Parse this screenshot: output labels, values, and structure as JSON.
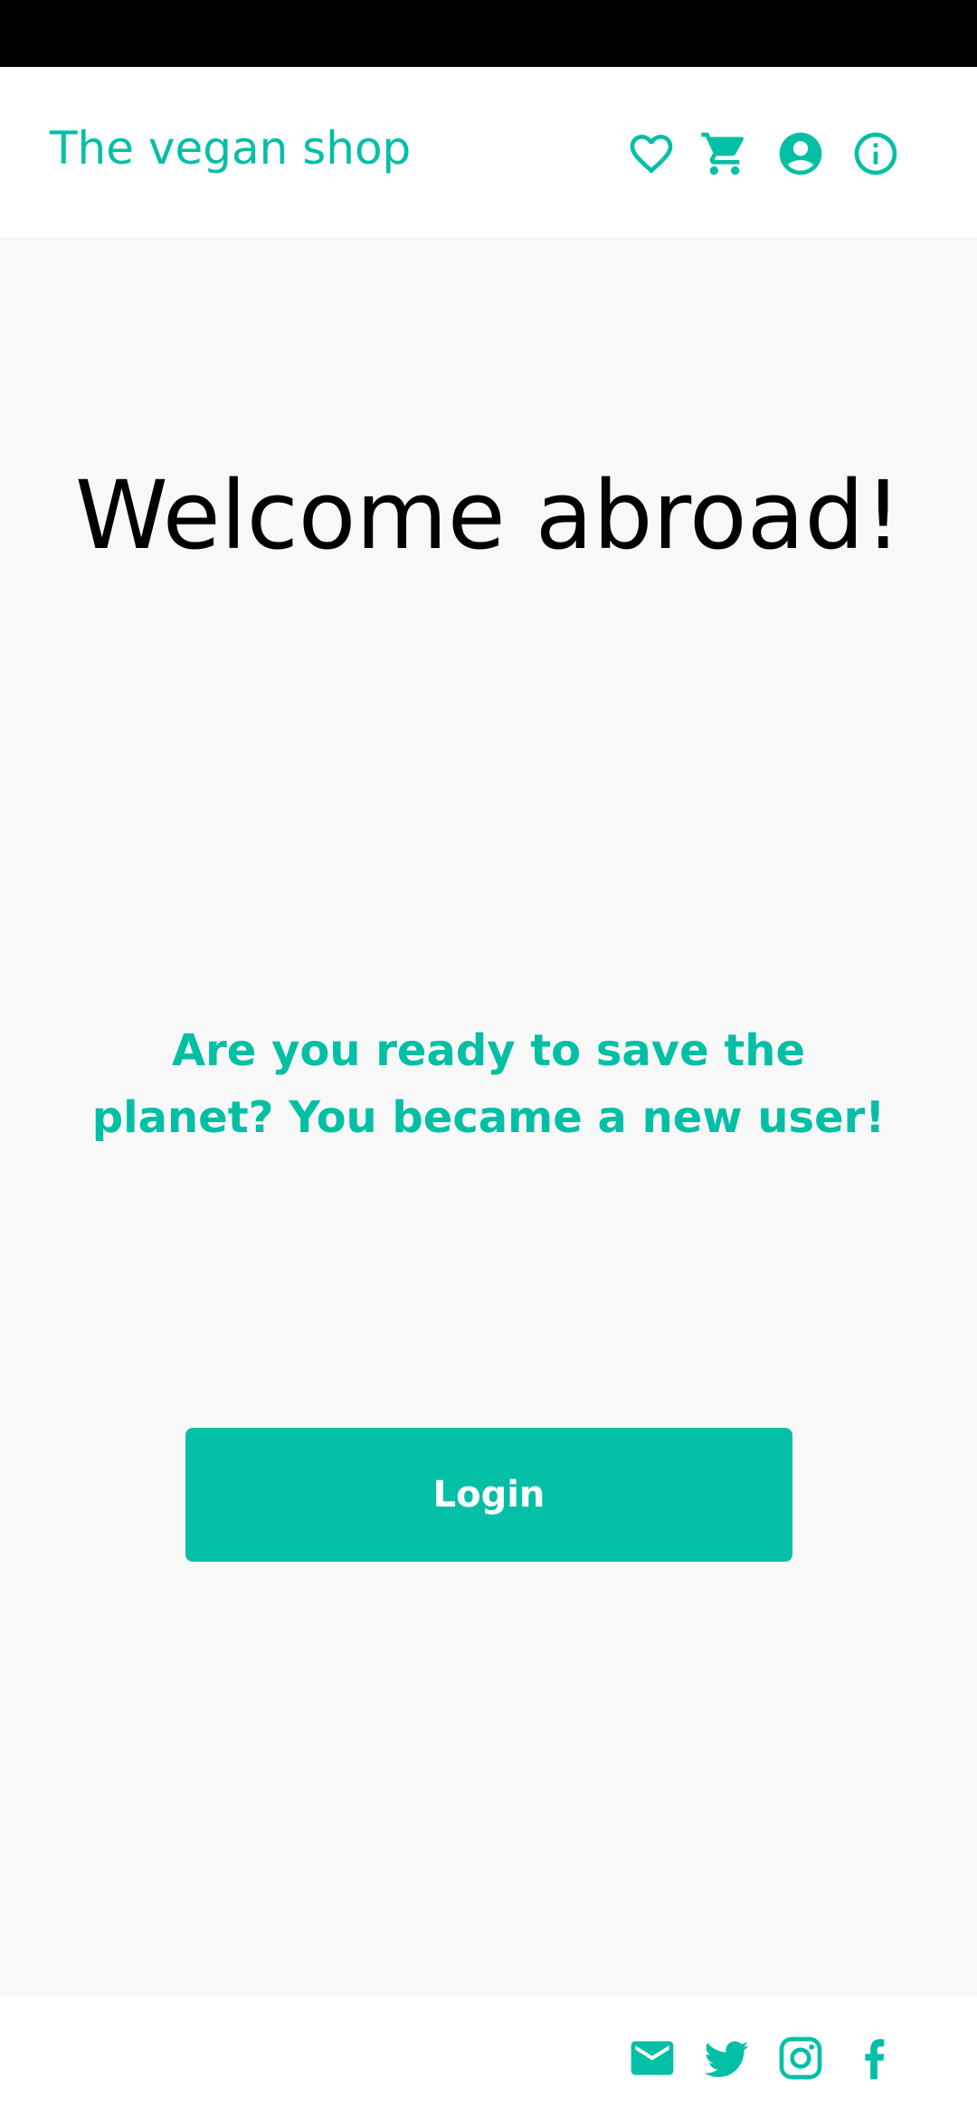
{
  "header": {
    "title": "The vegan shop",
    "icons": [
      "favorite-icon",
      "cart-icon",
      "account-icon",
      "info-icon"
    ]
  },
  "main": {
    "heading": "Welcome abroad!",
    "subtitle": "Are you ready to save the planet? You became a new user!",
    "login_label": "Login"
  },
  "footer": {
    "icons": [
      "mail-icon",
      "twitter-icon",
      "instagram-icon",
      "facebook-icon"
    ]
  },
  "colors": {
    "accent": "#03bfa5",
    "status_bar": "#000000",
    "background": "#f8f8f8",
    "surface": "#ffffff"
  }
}
